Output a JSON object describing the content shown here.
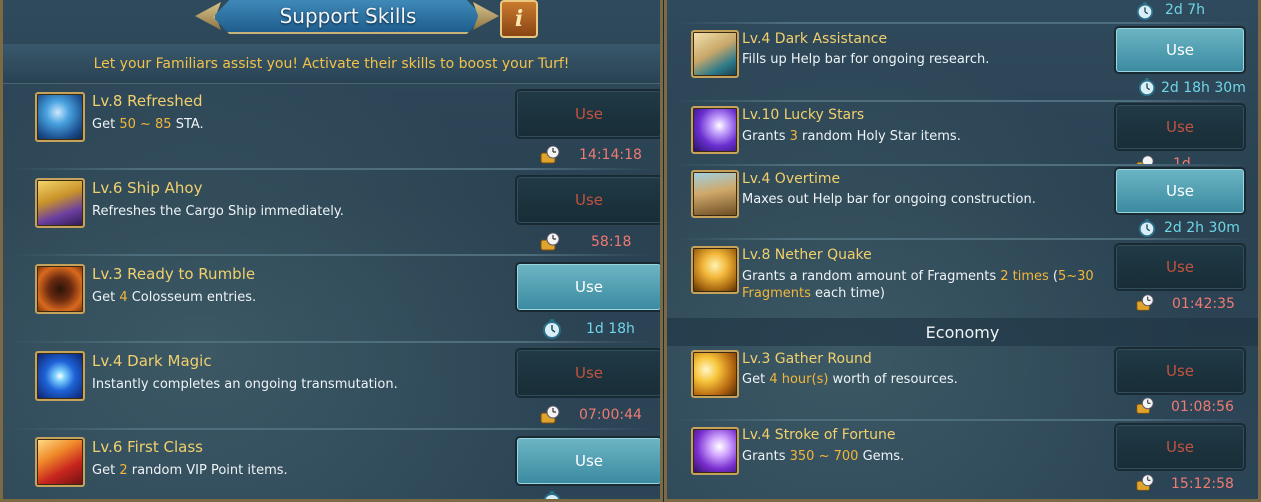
{
  "header": {
    "title": "Support Skills",
    "info_label": "i",
    "subtitle": "Let your Familiars assist you!  Activate their skills to boost your Turf!"
  },
  "left": {
    "skills": [
      {
        "name": "Lv.8 Refreshed",
        "desc_pre": "Get ",
        "hl": "50 ~ 85",
        "desc_post": " STA.",
        "button": "Use",
        "enabled": false,
        "timer": "14:14:18",
        "timer_icon": "cooldown-clock-icon",
        "icon": "refreshed-icon"
      },
      {
        "name": "Lv.6 Ship Ahoy",
        "desc_pre": "Refreshes the Cargo Ship immediately.",
        "hl": "",
        "desc_post": "",
        "button": "Use",
        "enabled": false,
        "timer": "58:18",
        "timer_icon": "cooldown-clock-icon",
        "icon": "ship-ahoy-icon"
      },
      {
        "name": "Lv.3 Ready to Rumble",
        "desc_pre": "Get ",
        "hl": "4",
        "desc_post": " Colosseum entries.",
        "button": "Use",
        "enabled": true,
        "timer": "1d 18h",
        "timer_icon": "duration-stopwatch-icon",
        "icon": "ready-to-rumble-icon"
      },
      {
        "name": "Lv.4 Dark Magic",
        "desc_pre": "Instantly completes an ongoing transmutation.",
        "hl": "",
        "desc_post": "",
        "button": "Use",
        "enabled": false,
        "timer": "07:00:44",
        "timer_icon": "cooldown-clock-icon",
        "icon": "dark-magic-icon"
      },
      {
        "name": "Lv.6 First Class",
        "desc_pre": "Get ",
        "hl": "2",
        "desc_post": " random VIP Point items.",
        "button": "Use",
        "enabled": true,
        "timer": "",
        "timer_icon": "duration-stopwatch-icon",
        "icon": "first-class-icon"
      }
    ]
  },
  "right": {
    "top_timer": "2d 7h",
    "skills": [
      {
        "name": "Lv.4 Dark Assistance",
        "desc_pre": "Fills up Help bar for ongoing research.",
        "hl": "",
        "desc_post": "",
        "button": "Use",
        "enabled": true,
        "timer": "2d 18h 30m",
        "icon": "dark-assistance-icon"
      },
      {
        "name": "Lv.10 Lucky Stars",
        "desc_pre": "Grants ",
        "hl": "3",
        "desc_post": " random Holy Star items.",
        "button": "Use",
        "enabled": false,
        "timer": "1d",
        "icon": "lucky-stars-icon"
      },
      {
        "name": "Lv.4 Overtime",
        "desc_pre": "Maxes out Help bar for ongoing construction.",
        "hl": "",
        "desc_post": "",
        "button": "Use",
        "enabled": true,
        "timer": "2d 2h 30m",
        "icon": "overtime-icon"
      },
      {
        "name": "Lv.8 Nether Quake",
        "desc_pre": "Grants a random amount of Fragments ",
        "hl": "2 times",
        "desc_mid": " (",
        "hl2": "5~30",
        "desc_post": "",
        "desc_line2_hl": "Fragments",
        "desc_line2": " each time)",
        "button": "Use",
        "enabled": false,
        "timer": "01:42:35",
        "icon": "nether-quake-icon"
      }
    ],
    "section": "Economy",
    "economy": [
      {
        "name": "Lv.3 Gather Round",
        "desc_pre": "Get ",
        "hl": "4 hour(s)",
        "desc_post": " worth of resources.",
        "button": "Use",
        "enabled": false,
        "timer": "01:08:56",
        "icon": "gather-round-icon"
      },
      {
        "name": "Lv.4 Stroke of Fortune",
        "desc_pre": "Grants ",
        "hl": "350 ~ 700",
        "desc_post": " Gems.",
        "button": "Use",
        "enabled": false,
        "timer": "15:12:58",
        "icon": "stroke-of-fortune-icon"
      }
    ]
  },
  "colors": {
    "gold_text": "#f1d06c",
    "highlight": "#f2b63a",
    "cooldown": "#f07a72",
    "duration": "#6ed6e6",
    "button_on": "#4f9fb2",
    "button_off": "#1d3641"
  }
}
